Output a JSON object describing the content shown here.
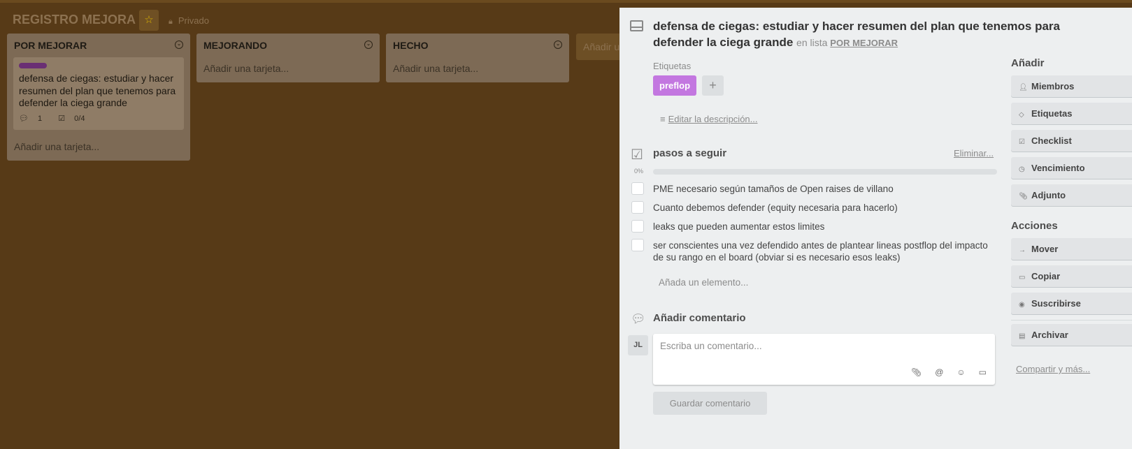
{
  "board": {
    "title": "REGISTRO MEJORA",
    "star_icon": "star-icon",
    "visibility": "Privado"
  },
  "lists": [
    {
      "name": "POR MEJORAR",
      "cards": [
        {
          "label_color": "#6a2f74",
          "title": "defensa de ciegas: estudiar y hacer resumen del plan que tenemos para defender la ciega grande",
          "comments": "1",
          "checklist": "0/4"
        }
      ],
      "add_card": "Añadir una tarjeta..."
    },
    {
      "name": "MEJORANDO",
      "cards": [],
      "add_card": "Añadir una tarjeta..."
    },
    {
      "name": "HECHO",
      "cards": [],
      "add_card": "Añadir una tarjeta..."
    }
  ],
  "add_list": "Añadir u",
  "modal": {
    "title": "defensa de ciegas: estudiar y hacer resumen del plan que tenemos para defender la ciega grande",
    "in_list_prefix": "en lista",
    "in_list_name": "POR MEJORAR",
    "labels_heading": "Etiquetas",
    "labels": [
      {
        "name": "preflop",
        "color": "#c377e0"
      }
    ],
    "add_label": "+",
    "edit_description": "Editar la descripción...",
    "checklist": {
      "title": "pasos a seguir",
      "delete": "Eliminar...",
      "percent": "0%",
      "progress": 0,
      "items": [
        "PME necesario según tamaños de Open raises de villano",
        "Cuanto debemos defender (equity necesaria para hacerlo)",
        "leaks que pueden aumentar estos limites",
        "ser conscientes una vez defendido antes de plantear lineas postflop del impacto de su rango en el board (obviar si es necesario esos leaks)"
      ],
      "add_item": "Añada un elemento..."
    },
    "comment": {
      "title": "Añadir comentario",
      "avatar": "JL",
      "placeholder": "Escriba un comentario...",
      "save": "Guardar comentario"
    },
    "sidebar": {
      "add_heading": "Añadir",
      "add_buttons": [
        "Miembros",
        "Etiquetas",
        "Checklist",
        "Vencimiento",
        "Adjunto"
      ],
      "actions_heading": "Acciones",
      "action_buttons": [
        "Mover",
        "Copiar",
        "Suscribirse"
      ],
      "archive": "Archivar",
      "share": "Compartir y más..."
    }
  }
}
